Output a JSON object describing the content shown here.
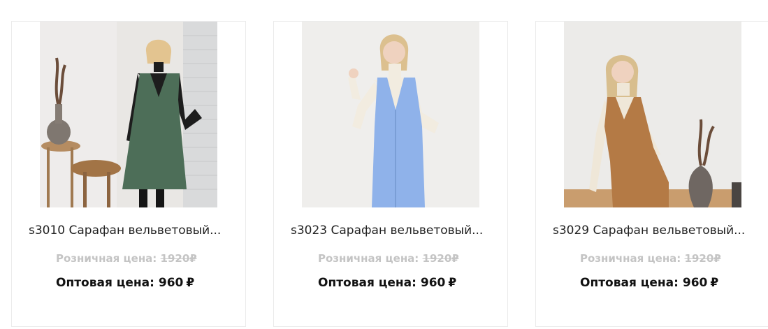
{
  "products": [
    {
      "title": "s3010 Сарафан вельветовый...",
      "retail_label": "Розничная цена:",
      "retail_price": "1920",
      "wholesale_label": "Оптовая цена:",
      "wholesale_price": "960",
      "currency": "₽",
      "dress_color": "#4d6e58"
    },
    {
      "title": "s3023 Сарафан вельветовый...",
      "retail_label": "Розничная цена:",
      "retail_price": "1920",
      "wholesale_label": "Оптовая цена:",
      "wholesale_price": "960",
      "currency": "₽",
      "dress_color": "#8fb2ea"
    },
    {
      "title": "s3029 Сарафан вельветовый...",
      "retail_label": "Розничная цена:",
      "retail_price": "1920",
      "wholesale_label": "Оптовая цена:",
      "wholesale_price": "960",
      "currency": "₽",
      "dress_color": "#b47a45"
    }
  ]
}
